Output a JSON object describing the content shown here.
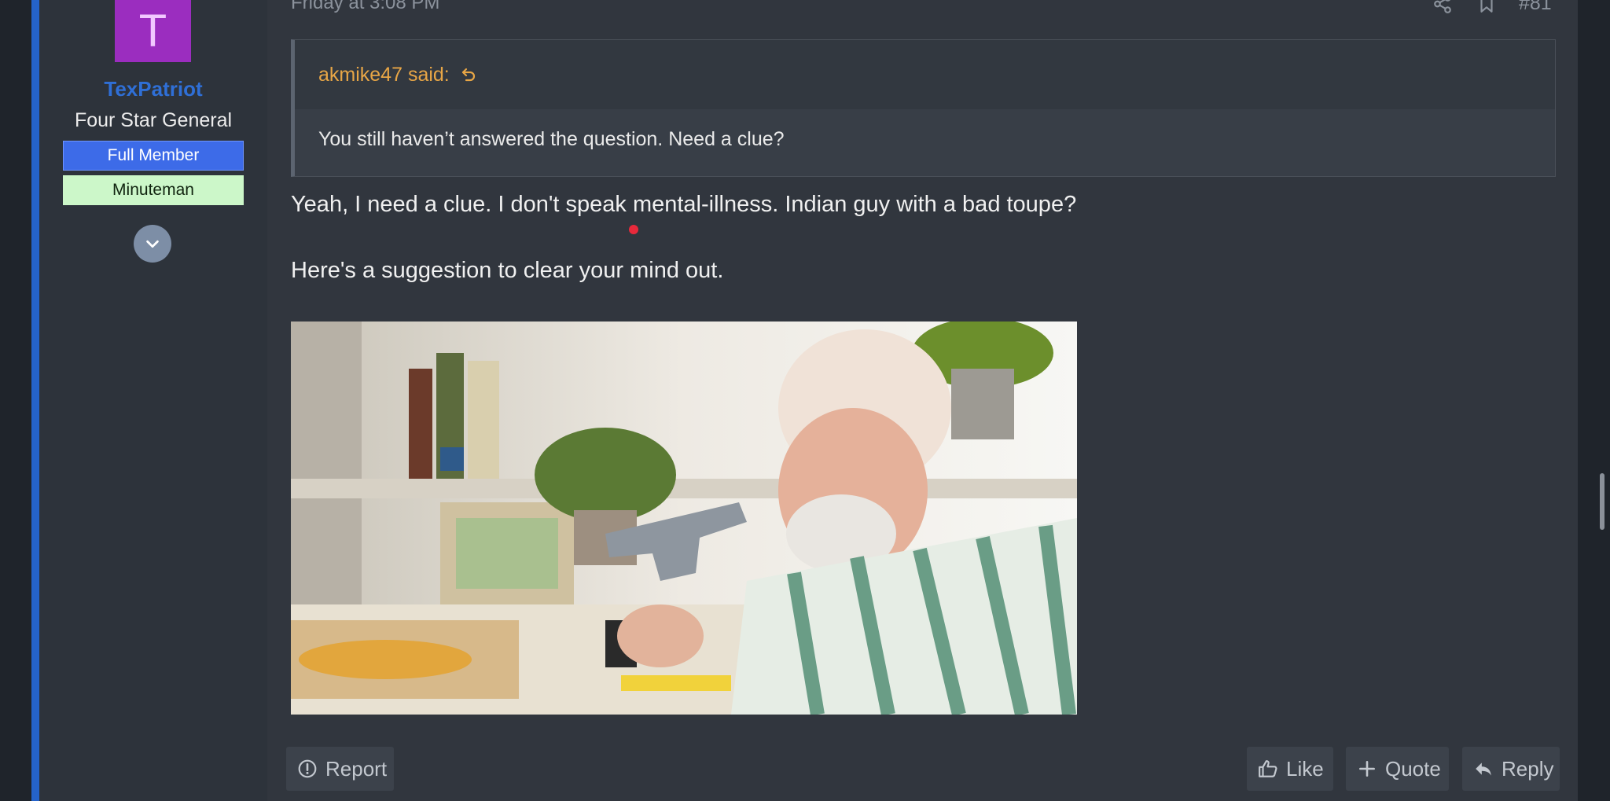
{
  "post": {
    "date": "Friday at 3:08 PM",
    "number": "#81",
    "author": {
      "avatar_letter": "T",
      "avatar_color": "#9b2dbf",
      "username": "TexPatriot",
      "title": "Four Star General",
      "banners": [
        "Full Member",
        "Minuteman"
      ]
    },
    "quote": {
      "author_label": "akmike47 said:",
      "text": "You still haven’t answered the question. Need a clue?"
    },
    "body": {
      "line1": "Yeah, I need a clue. I don't speak mental-illness. Indian guy with a bad toupe?",
      "line2": "Here's a suggestion to clear your mind out."
    },
    "image": {
      "description_icon": "photo-old-man-holding-pistol"
    }
  },
  "actions": {
    "report_label": "Report",
    "like_label": "Like",
    "quote_label": "Quote",
    "reply_label": "Reply"
  },
  "colors": {
    "accent": "#2563c9",
    "username": "#2f6fd6",
    "quote_author": "#e8a646",
    "full_member_banner": "#3d6be8",
    "minuteman_banner": "#ccf7c9"
  }
}
